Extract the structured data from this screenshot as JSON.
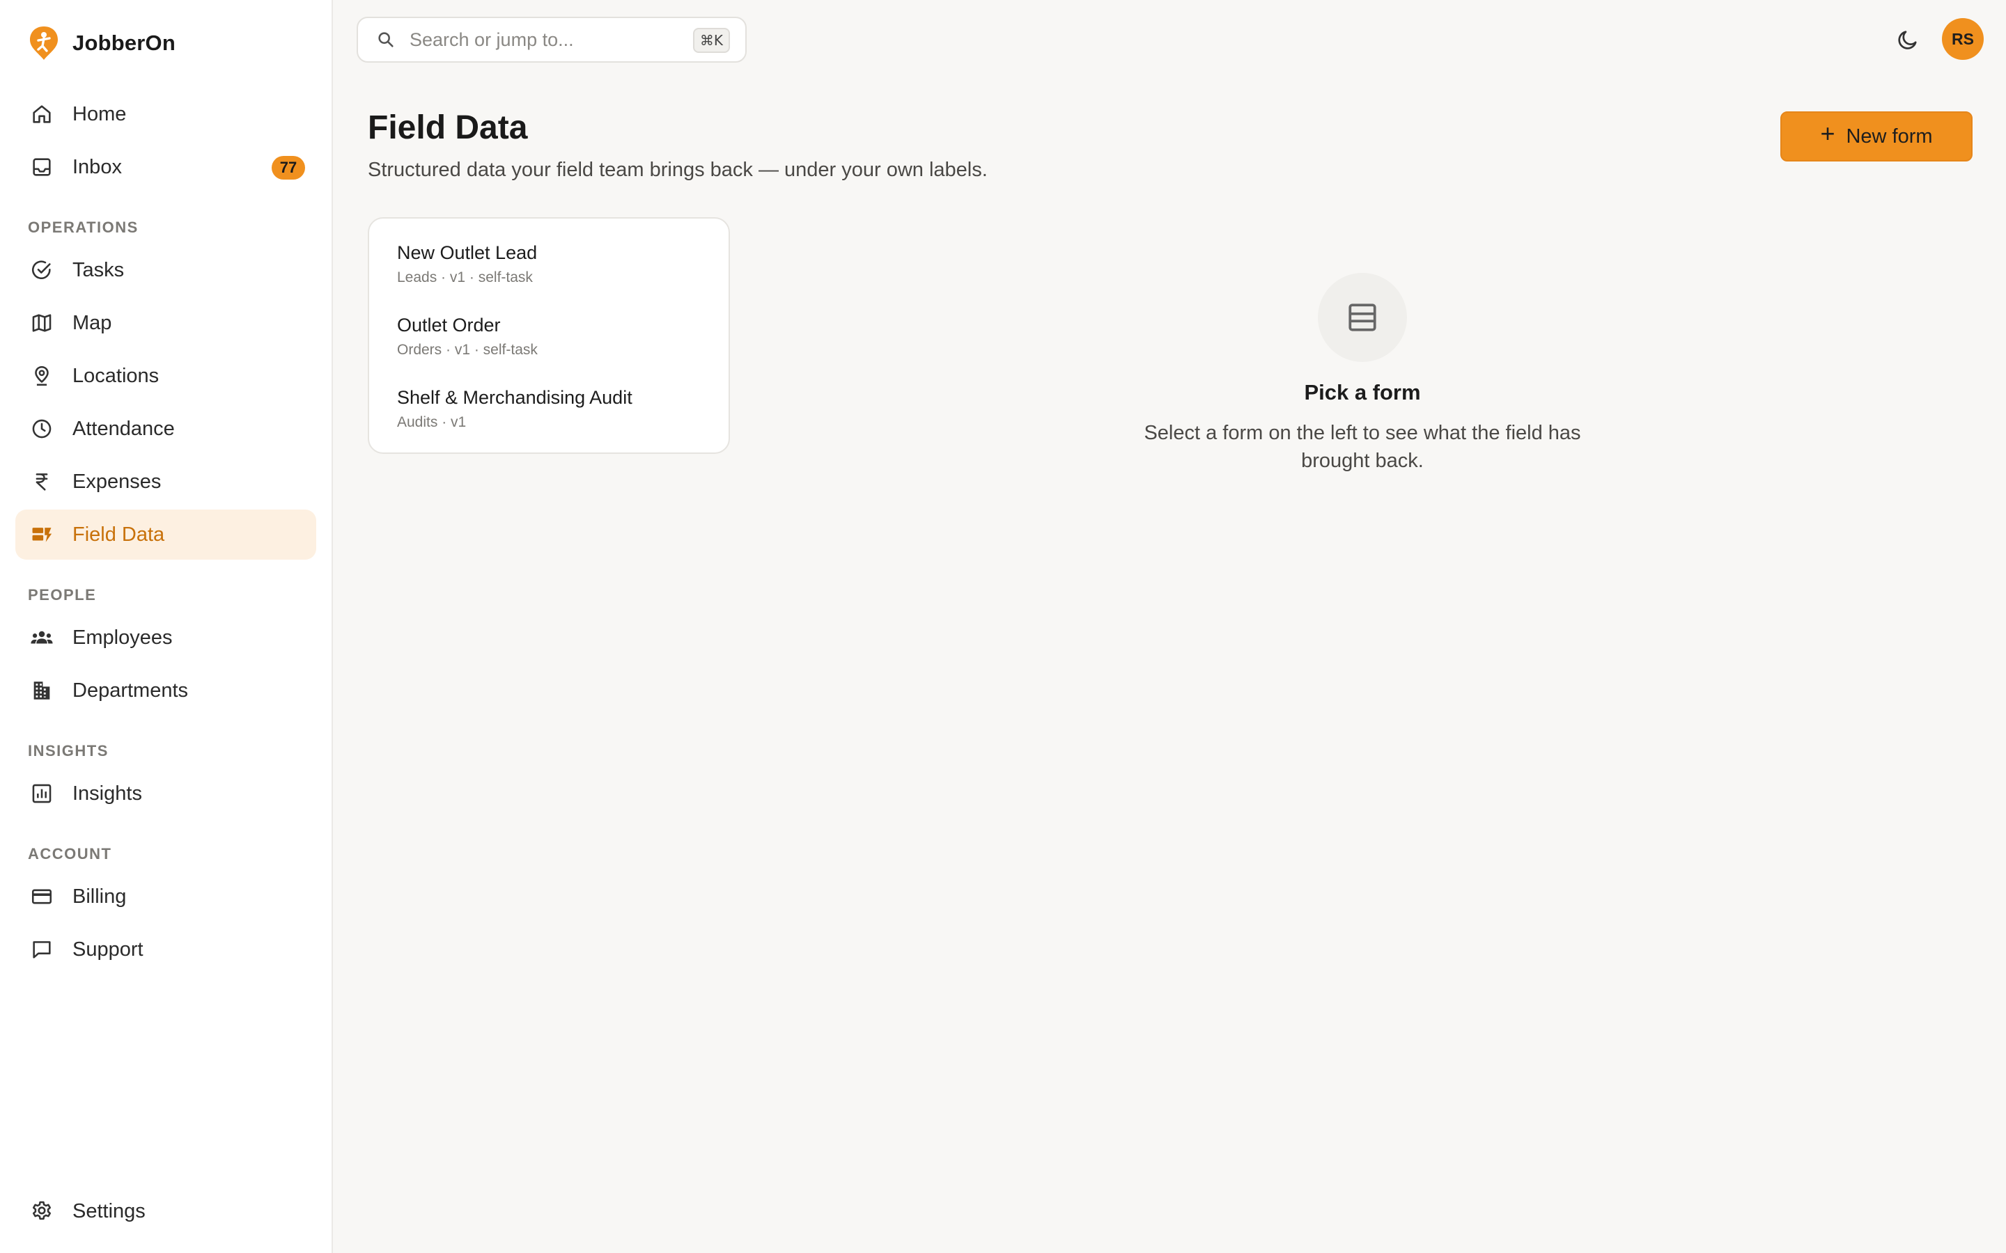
{
  "app": {
    "name": "JobberOn"
  },
  "nav": {
    "home": "Home",
    "inbox": "Inbox",
    "inbox_badge": "77",
    "operations_label": "OPERATIONS",
    "tasks": "Tasks",
    "map": "Map",
    "locations": "Locations",
    "attendance": "Attendance",
    "expenses": "Expenses",
    "field_data": "Field Data",
    "people_label": "PEOPLE",
    "employees": "Employees",
    "departments": "Departments",
    "insights_label": "INSIGHTS",
    "insights": "Insights",
    "account_label": "ACCOUNT",
    "billing": "Billing",
    "support": "Support",
    "settings": "Settings"
  },
  "topbar": {
    "search_placeholder": "Search or jump to...",
    "shortcut": "⌘K",
    "avatar_initials": "RS"
  },
  "page": {
    "title": "Field Data",
    "subtitle": "Structured data your field team brings back — under your own labels.",
    "new_form_label": "New form"
  },
  "forms": [
    {
      "name": "New Outlet Lead",
      "meta": "Leads · v1 · self-task"
    },
    {
      "name": "Outlet Order",
      "meta": "Orders · v1 · self-task"
    },
    {
      "name": "Shelf & Merchandising Audit",
      "meta": "Audits · v1"
    }
  ],
  "empty_state": {
    "title": "Pick a form",
    "description": "Select a form on the left to see what the field has brought back."
  },
  "colors": {
    "accent": "#f0901e",
    "active_bg": "#fdf0e1",
    "active_text": "#c8710a"
  }
}
